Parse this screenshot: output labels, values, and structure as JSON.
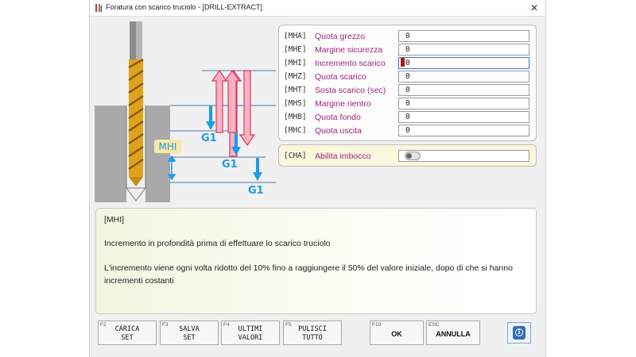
{
  "window": {
    "title": "Foratura con scarico truciolo - [DRILL-EXTRACT]",
    "close_glyph": "✕"
  },
  "diagram": {
    "mhi_label": "MHI",
    "g1_label": "G1",
    "colors": {
      "drill": "#e0a21b",
      "stock": "#a9a9a9",
      "down_arrow": "#1e9be8",
      "retract_arrow": "#ef3e6a",
      "line": "#5a7ea8"
    }
  },
  "params": [
    {
      "code": "[MHA]",
      "label": "Quota grezzo",
      "value": "0",
      "active": false
    },
    {
      "code": "[MHE]",
      "label": "Margine sicurezza",
      "value": "0",
      "active": false
    },
    {
      "code": "[MHI]",
      "label": "Incremento scarico",
      "value": "0",
      "active": true
    },
    {
      "code": "[MHZ]",
      "label": "Quota scarico",
      "value": "0",
      "active": false
    },
    {
      "code": "[MHT]",
      "label": "Sosta scarico (sec)",
      "value": "0",
      "active": false
    },
    {
      "code": "[MHS]",
      "label": "Margine rientro",
      "value": "0",
      "active": false
    },
    {
      "code": "[MHB]",
      "label": "Quota fondo",
      "value": "0",
      "active": false
    },
    {
      "code": "[MHC]",
      "label": "Quota uscita",
      "value": "0",
      "active": false
    }
  ],
  "cha": {
    "code": "[CHA]",
    "label": "Abilita imbocco",
    "toggle_on": false
  },
  "help": {
    "code": "[MHI]",
    "title": "Incremento in profondità prima di effettuare lo scarico truciolo",
    "desc": "L'incremento viene ogni volta ridotto del 10% fino a raggiungere il 50% del valore iniziale, dopo di che si hanno incrementi costanti"
  },
  "fkeys": [
    {
      "key": "F2",
      "label": "CARICA\nSET"
    },
    {
      "key": "F3",
      "label": "SALVA\nSET"
    },
    {
      "key": "F4",
      "label": "ULTIMI\nVALORI"
    },
    {
      "key": "F5",
      "label": "PULISCI\nTUTTO"
    },
    {
      "key": "F10",
      "label": "OK"
    },
    {
      "key": "ESC",
      "label": "ANNULLA"
    }
  ]
}
